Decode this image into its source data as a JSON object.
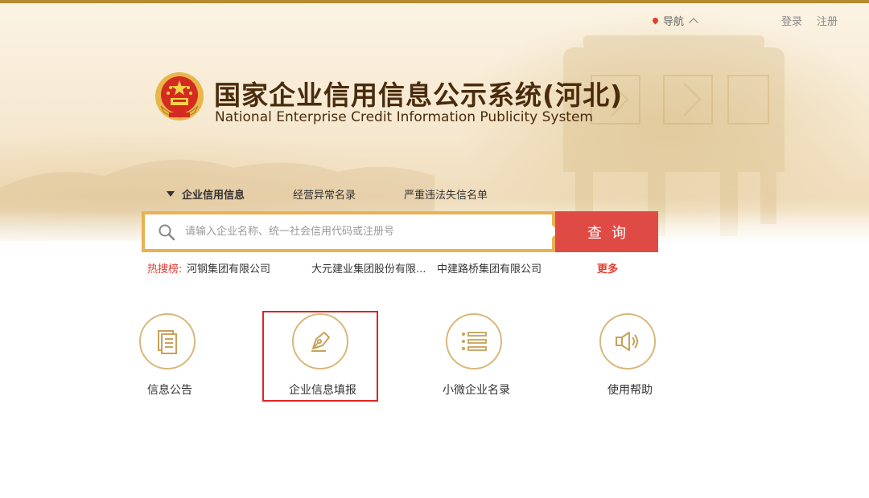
{
  "header": {
    "nav_label": "导航",
    "login": "登录",
    "register": "注册",
    "title_cn": "国家企业信用信息公示系统(河北)",
    "title_en": "National Enterprise Credit Information Publicity System"
  },
  "tabs": [
    {
      "label": "企业信用信息",
      "active": true
    },
    {
      "label": "经营异常名录",
      "active": false
    },
    {
      "label": "严重违法失信名单",
      "active": false
    }
  ],
  "search": {
    "placeholder": "请输入企业名称、统一社会信用代码或注册号",
    "value": "",
    "button_label": "查询"
  },
  "hot_search": {
    "label": "热搜榜:",
    "items": [
      "河钢集团有限公司",
      "大元建业集团股份有限...",
      "中建路桥集团有限公司"
    ],
    "more": "更多"
  },
  "features": [
    {
      "label": "信息公告",
      "icon": "document-icon"
    },
    {
      "label": "企业信息填报",
      "icon": "pen-nib-icon",
      "highlighted": true
    },
    {
      "label": "小微企业名录",
      "icon": "list-icon"
    },
    {
      "label": "使用帮助",
      "icon": "speaker-icon"
    }
  ],
  "colors": {
    "accent_gold": "#d8b87a",
    "search_border": "#e8b252",
    "query_button": "#e04a45",
    "hot_red": "#e53b2e",
    "title_brown": "#4a2c0d",
    "highlight_red": "#e12323"
  }
}
